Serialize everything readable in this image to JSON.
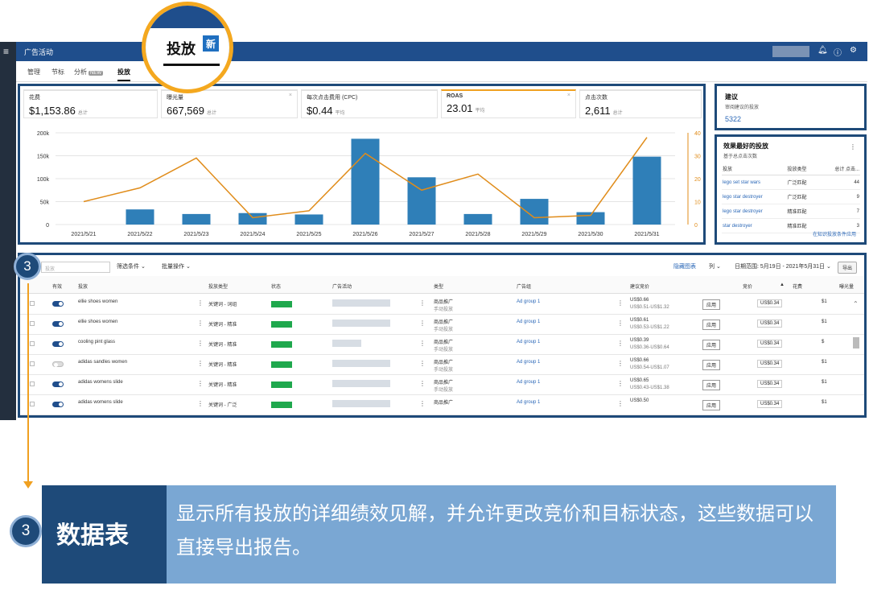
{
  "app": {
    "title": "广告活动"
  },
  "tabs": [
    {
      "label": "管理"
    },
    {
      "label": "节标"
    },
    {
      "label": "分析",
      "badge": "NEW"
    },
    {
      "label": "投放"
    }
  ],
  "callout": {
    "label": "投放",
    "badge": "新"
  },
  "kpis": [
    {
      "label": "花费",
      "value": "$1,153.86",
      "sub": "总计"
    },
    {
      "label": "曝光量",
      "value": "667,569",
      "sub": "总计"
    },
    {
      "label": "每次点击费用 (CPC)",
      "value": "$0.44",
      "sub": "平均"
    },
    {
      "label": "ROAS",
      "value": "23.01",
      "sub": "平均"
    },
    {
      "label": "点击次数",
      "value": "2,611",
      "sub": "总计"
    }
  ],
  "chart_data": {
    "type": "bar",
    "categories": [
      "2021/5/21",
      "2021/5/22",
      "2021/5/23",
      "2021/5/24",
      "2021/5/25",
      "2021/5/26",
      "2021/5/27",
      "2021/5/28",
      "2021/5/29",
      "2021/5/30",
      "2021/5/31"
    ],
    "series": [
      {
        "values": [
          0,
          33000,
          23000,
          25000,
          22000,
          187000,
          103000,
          23000,
          56000,
          27000,
          148000
        ],
        "color": "#2f7fb8"
      },
      {
        "values": [
          10,
          16,
          29,
          3,
          6,
          31,
          15,
          22,
          3,
          4,
          38
        ],
        "color": "#e08c1a"
      }
    ],
    "ylim_left": [
      0,
      200000
    ],
    "yticks_left": [
      "0",
      "50k",
      "100k",
      "150k",
      "200k"
    ],
    "ylim_right": [
      0,
      40
    ],
    "yticks_right": [
      "0",
      "10",
      "20",
      "30",
      "40"
    ],
    "grid": true
  },
  "recommend": {
    "title": "建议",
    "sub": "审阅建议的投放",
    "link": "5322"
  },
  "best": {
    "title": "效果最好的投放",
    "sub": "基于总点击次数",
    "headers": [
      "投放",
      "投放类型",
      "总计 点击..."
    ],
    "rows": [
      {
        "name": "lego set star wars",
        "type": "广泛匹配",
        "clicks": "44"
      },
      {
        "name": "lego star destroyer",
        "type": "广泛匹配",
        "clicks": "9"
      },
      {
        "name": "lego star destroyer",
        "type": "精准匹配",
        "clicks": "7"
      },
      {
        "name": "star destroyer",
        "type": "精准匹配",
        "clicks": "3"
      }
    ],
    "footer_link": "在知识投放条件应用"
  },
  "toolbar": {
    "search_placeholder": "投放",
    "filter": "筛选条件",
    "bulk": "批量操作",
    "hide_chart": "隐藏图表",
    "columns": "列",
    "date_range": "日期范围: 5月19日 - 2021年5月31日",
    "export": "导出"
  },
  "table": {
    "headers": [
      "有效",
      "投放",
      "投放类型",
      "状态",
      "广告活动",
      "类型",
      "广告组",
      "建议竞价",
      "竞价",
      "花费",
      "曝光量"
    ],
    "rows": [
      {
        "on": true,
        "target": "ellie shoes women",
        "ttype": "关键词 - 词组",
        "ctype": "商品推广",
        "ctype2": "手动投放",
        "group": "Ad group 1",
        "sugg": "US$0.66",
        "sugg_range": "US$0.51-US$1.32",
        "bid": "US$0.34",
        "spend": "$1"
      },
      {
        "on": true,
        "target": "ellie shoes women",
        "ttype": "关键词 - 精准",
        "ctype": "商品推广",
        "ctype2": "手动投放",
        "group": "Ad group 1",
        "sugg": "US$0.61",
        "sugg_range": "US$0.53-US$1.22",
        "bid": "US$0.34",
        "spend": "$1"
      },
      {
        "on": true,
        "target": "cooling pint glass",
        "ttype": "关键词 - 精准",
        "ctype": "商品推广",
        "ctype2": "手动投放",
        "group": "Ad group 1",
        "sugg": "US$0.39",
        "sugg_range": "US$0.36-US$0.64",
        "bid": "US$0.34",
        "spend": "$"
      },
      {
        "on": false,
        "target": "adidas sandles women",
        "ttype": "关键词 - 精准",
        "ctype": "商品推广",
        "ctype2": "手动投放",
        "group": "Ad group 1",
        "sugg": "US$0.66",
        "sugg_range": "US$0.54-US$1.07",
        "bid": "US$0.34",
        "spend": "$1"
      },
      {
        "on": true,
        "target": "adidas womens slide",
        "ttype": "关键词 - 精准",
        "ctype": "商品推广",
        "ctype2": "手动投放",
        "group": "Ad group 1",
        "sugg": "US$0.65",
        "sugg_range": "US$0.43-US$1.38",
        "bid": "US$0.34",
        "spend": "$1"
      },
      {
        "on": true,
        "target": "adidas womens slide",
        "ttype": "关键词 - 广泛",
        "ctype": "商品推广",
        "ctype2": "",
        "group": "Ad group 1",
        "sugg": "US$0.50",
        "sugg_range": "",
        "bid": "US$0.34",
        "spend": "$1"
      }
    ],
    "apply_label": "应用"
  },
  "badge_num": "3",
  "footer": {
    "title": "数据表",
    "text": "显示所有投放的详细绩效见解，并允许更改竞价和目标状态，这些数据可以直接导出报告。"
  }
}
